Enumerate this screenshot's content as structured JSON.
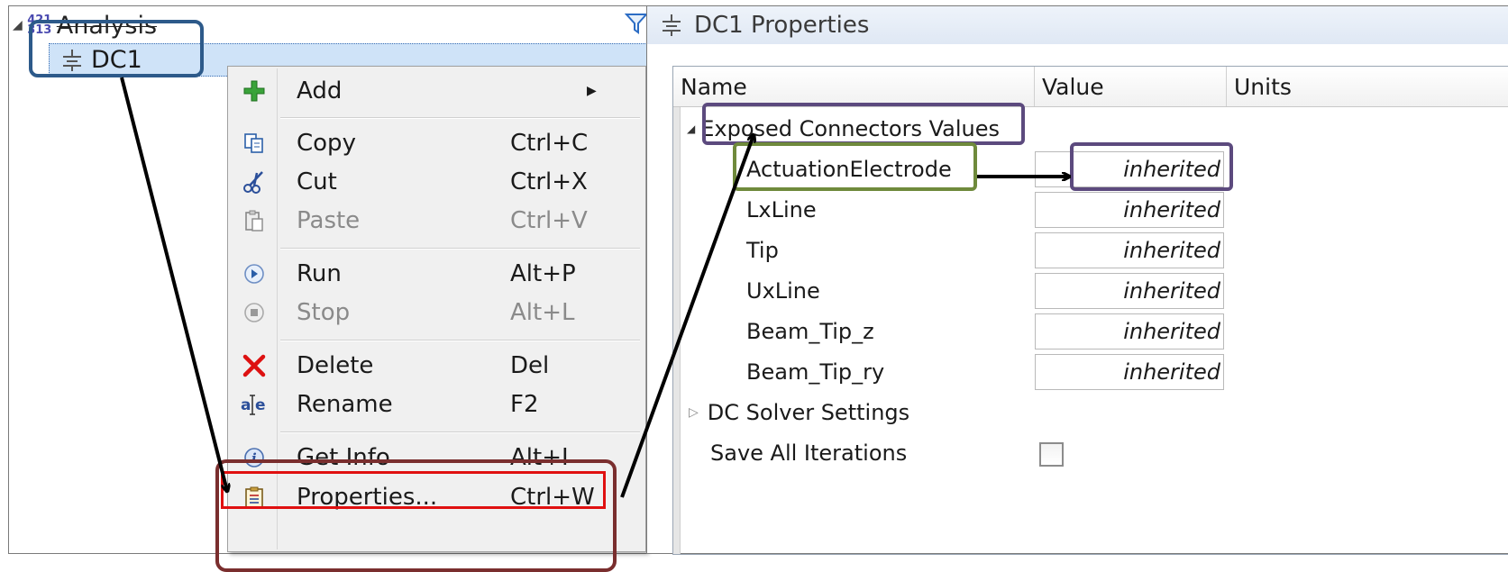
{
  "tree": {
    "root_label": "Analysis",
    "root_icon_digits": [
      "421",
      "313"
    ],
    "child_label": "DC1"
  },
  "context_menu": {
    "items": [
      {
        "label": "Add",
        "shortcut": "",
        "icon": "add-plus-icon",
        "enabled": true,
        "has_submenu": true
      },
      {
        "label": "Copy",
        "shortcut": "Ctrl+C",
        "icon": "copy-icon",
        "enabled": true
      },
      {
        "label": "Cut",
        "shortcut": "Ctrl+X",
        "icon": "scissors-icon",
        "enabled": true
      },
      {
        "label": "Paste",
        "shortcut": "Ctrl+V",
        "icon": "paste-icon",
        "enabled": false
      },
      {
        "label": "Run",
        "shortcut": "Alt+P",
        "icon": "run-icon",
        "enabled": true
      },
      {
        "label": "Stop",
        "shortcut": "Alt+L",
        "icon": "stop-icon",
        "enabled": false
      },
      {
        "label": "Delete",
        "shortcut": "Del",
        "icon": "delete-x-icon",
        "enabled": true
      },
      {
        "label": "Rename",
        "shortcut": "F2",
        "icon": "rename-icon",
        "enabled": true
      },
      {
        "label": "Get Info",
        "shortcut": "Alt+I",
        "icon": "info-icon",
        "enabled": true
      },
      {
        "label": "Properties...",
        "shortcut": "Ctrl+W",
        "icon": "properties-icon",
        "enabled": true
      }
    ]
  },
  "properties": {
    "title": "DC1 Properties",
    "columns": [
      "Name",
      "Value",
      "Units"
    ],
    "group_exposed": "Exposed Connectors Values",
    "connectors": [
      {
        "name": "ActuationElectrode",
        "value": "inherited"
      },
      {
        "name": "LxLine",
        "value": "inherited"
      },
      {
        "name": "Tip",
        "value": "inherited"
      },
      {
        "name": "UxLine",
        "value": "inherited"
      },
      {
        "name": "Beam_Tip_z",
        "value": "inherited"
      },
      {
        "name": "Beam_Tip_ry",
        "value": "inherited"
      }
    ],
    "group_solver": "DC Solver Settings",
    "save_all_label": "Save All Iterations",
    "save_all_checked": false
  },
  "colors": {
    "selection": "#cfe3f8",
    "highlight_blue": "#2d5a8a",
    "highlight_red": "#e01010",
    "highlight_brown": "#7a2e2e",
    "highlight_purple": "#5c4a7e",
    "highlight_green": "#6f8a3c"
  }
}
